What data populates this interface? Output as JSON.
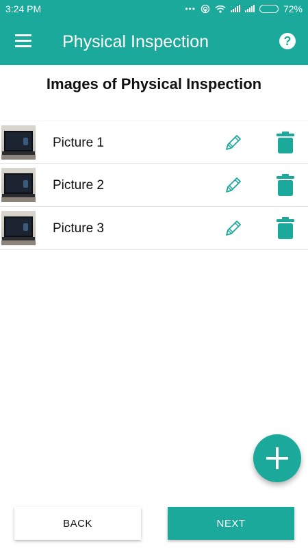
{
  "status_bar": {
    "time": "3:24 PM",
    "dots": "•••",
    "battery": "72%",
    "battery_level": 0.72,
    "icons": [
      "hotspot-icon",
      "wifi-icon",
      "signal-icon",
      "signal-icon",
      "battery-icon"
    ]
  },
  "app_bar": {
    "title": "Physical Inspection",
    "menu_icon": "hamburger-menu-icon",
    "help_icon": "help-icon",
    "help_glyph": "?"
  },
  "section_title": "Images of Physical Inspection",
  "items": [
    {
      "label": "Picture 1",
      "thumb": "laptop-photo"
    },
    {
      "label": "Picture 2",
      "thumb": "laptop-photo"
    },
    {
      "label": "Picture 3",
      "thumb": "laptop-photo"
    }
  ],
  "fab": {
    "icon": "plus-icon"
  },
  "buttons": {
    "back": "BACK",
    "next": "NEXT"
  },
  "colors": {
    "primary": "#1aa99a",
    "text": "#111111",
    "background": "#ffffff"
  }
}
